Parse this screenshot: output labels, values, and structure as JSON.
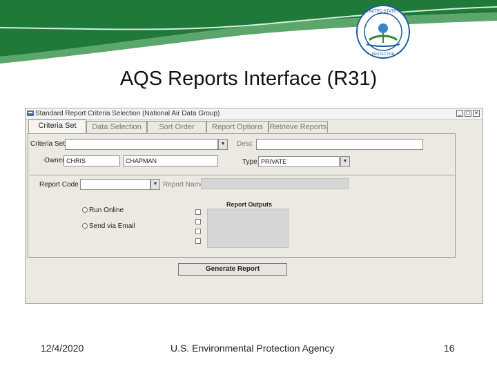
{
  "slide": {
    "title": "AQS Reports Interface (R31)",
    "footer_date": "12/4/2020",
    "footer_org": "U.S. Environmental Protection Agency",
    "page_number": "16",
    "seal_text": "UNITED STATES ENVIRONMENTAL PROTECTION AGENCY"
  },
  "window": {
    "title": "Standard Report Criteria Selection  (National Air Data Group)",
    "controls": [
      "_",
      "□",
      "×"
    ]
  },
  "tabs": [
    {
      "label": "Criteria Set",
      "active": true
    },
    {
      "label": "Data Selection",
      "active": false
    },
    {
      "label": "Sort Order",
      "active": false
    },
    {
      "label": "Report Options",
      "active": false
    },
    {
      "label": "Retrieve Reports",
      "active": false
    }
  ],
  "form": {
    "criteria_set_label": "Criteria Set",
    "criteria_set_value": "",
    "desc_label": "Desc",
    "desc_value": "",
    "owner_label": "Owner",
    "owner_first": "CHRIS",
    "owner_last": "CHAPMAN",
    "type_label": "Type",
    "type_value": "PRIVATE",
    "report_code_label": "Report Code",
    "report_code_value": "",
    "report_name_label": "Report Name",
    "report_name_value": "",
    "run_online_label": "Run Online",
    "send_email_label": "Send via Email",
    "report_outputs_label": "Report Outputs",
    "generate_label": "Generate Report"
  },
  "colors": {
    "banner_green": "#1f7a3a",
    "banner_light": "#8fc99a"
  }
}
